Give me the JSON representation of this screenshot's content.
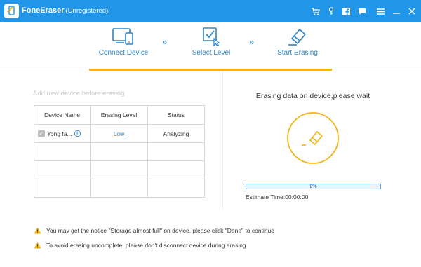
{
  "titlebar": {
    "app_name": "FoneEraser",
    "registration_status": "(Unregistered)",
    "icons": [
      "cart-icon",
      "key-icon",
      "facebook-icon",
      "chat-icon",
      "menu-icon",
      "minimize-icon",
      "close-icon"
    ],
    "background_color": "#2196e8"
  },
  "steps": [
    {
      "label": "Connect Device",
      "icon": "device-icon"
    },
    {
      "label": "Select Level",
      "icon": "checkbox-cursor-icon"
    },
    {
      "label": "Start Erasing",
      "icon": "eraser-icon"
    }
  ],
  "step_separator": "»",
  "progress_accent_color": "#f2b418",
  "left": {
    "add_hint": "Add new device before erasing",
    "columns": [
      "Device Name",
      "Erasing Level",
      "Status"
    ],
    "rows": [
      {
        "device_name": "Yong fa...",
        "level": "Low",
        "status": "Analyzing"
      }
    ]
  },
  "right": {
    "heading": "Erasing data on device,please wait",
    "progress_percent": 0,
    "progress_text": "0%",
    "estimate_time": "Estimate Time:00:00:00"
  },
  "notices": [
    "You may get the notice \"Storage almost full\" on device, please click \"Done\" to continue",
    "To avoid erasing uncomplete, please don't disconnect device during erasing"
  ]
}
